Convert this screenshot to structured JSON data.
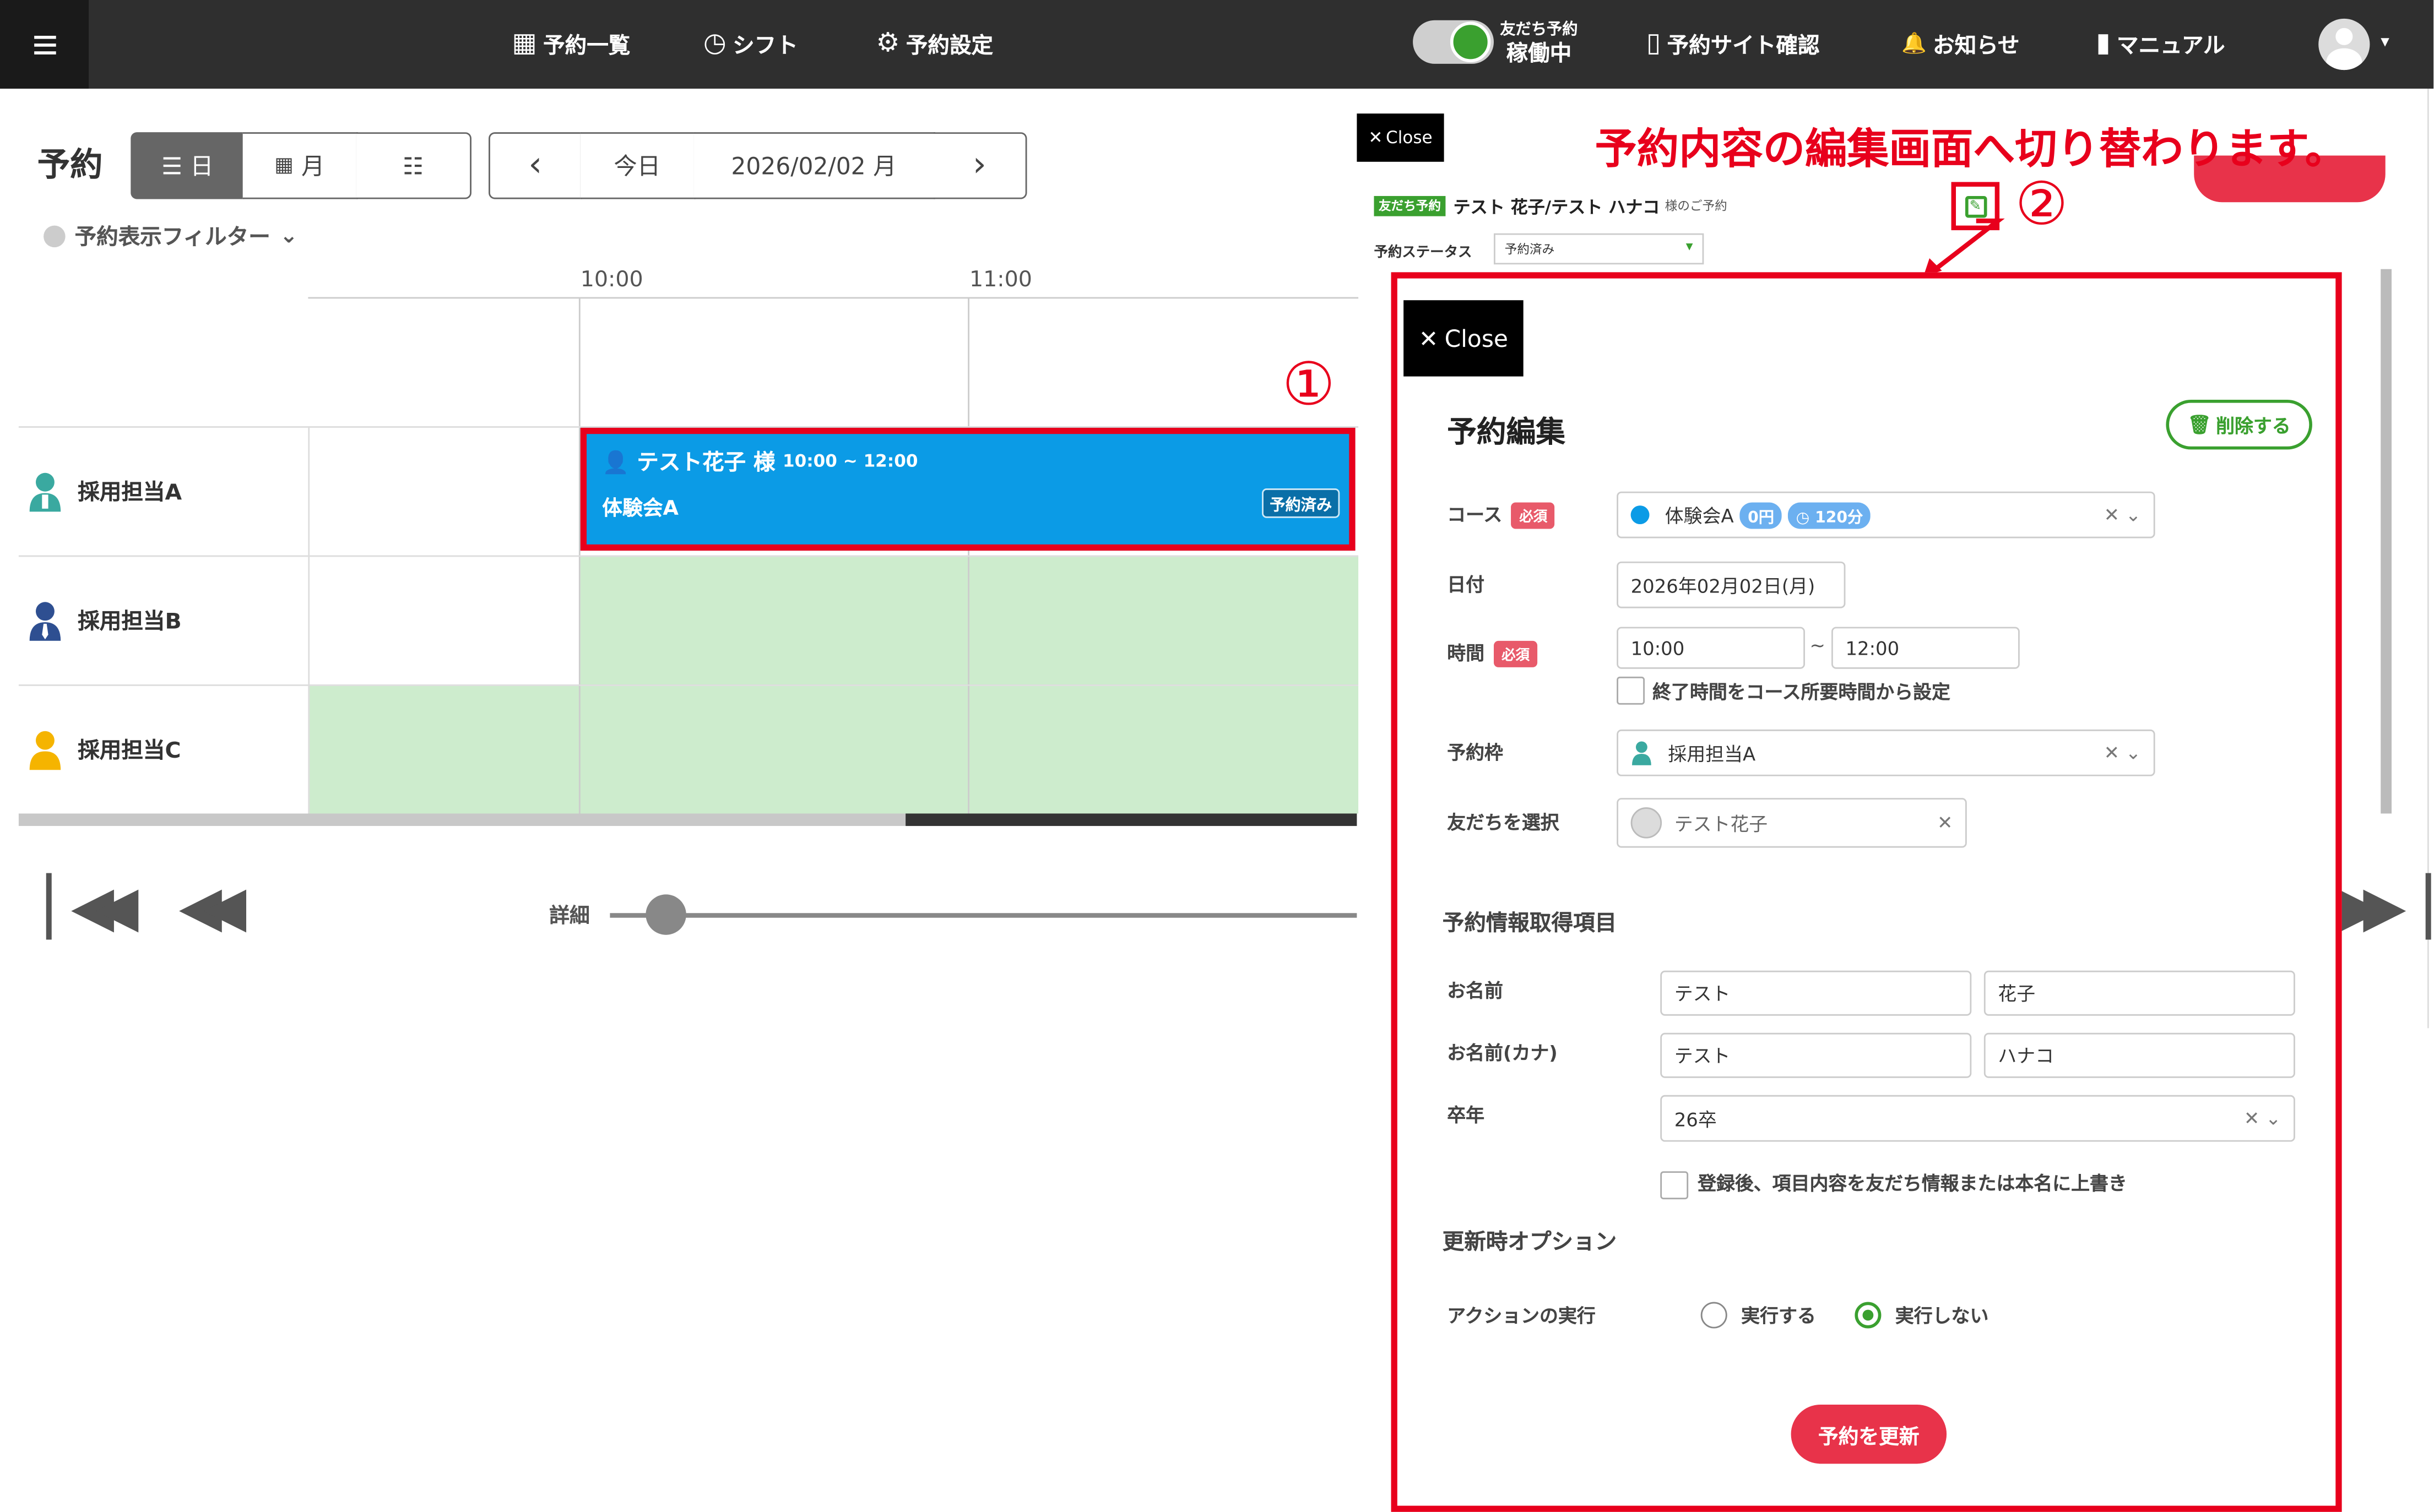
{
  "nav": {
    "items": [
      {
        "icon": "calendar-icon",
        "glyph": "▦",
        "label": "予約一覧"
      },
      {
        "icon": "clock-icon",
        "glyph": "◷",
        "label": "シフト"
      },
      {
        "icon": "gear-icon",
        "glyph": "⚙",
        "label": "予約設定"
      }
    ],
    "toggle_sub": "友だち予約",
    "toggle_main": "稼働中",
    "right_items": [
      {
        "icon": "phone-icon",
        "glyph": "▯",
        "label": "予約サイト確認"
      },
      {
        "icon": "bell-icon",
        "glyph": "🔔",
        "label": "お知らせ"
      },
      {
        "icon": "book-icon",
        "glyph": "▮",
        "label": "マニュアル"
      }
    ],
    "avatar_caret": "▾"
  },
  "toolbar": {
    "title": "予約",
    "view_day": "日",
    "view_month": "月",
    "view_list": "☷",
    "prev": "‹",
    "today": "今日",
    "date": "2026/02/02 月",
    "next": "›",
    "filter_label": "予約表示フィルター",
    "filter_caret": "⌄"
  },
  "calendar": {
    "times": [
      "10:00",
      "11:00"
    ],
    "staff": [
      {
        "name": "採用担当A",
        "icon_color": "#3aa9a0"
      },
      {
        "name": "採用担当B",
        "icon_color": "#2e4f91"
      },
      {
        "name": "採用担当C",
        "icon_color": "#f5b400"
      }
    ],
    "event": {
      "name": "テスト花子 様",
      "time": "10:00 ~ 12:00",
      "course": "体験会A",
      "status": "予約済み"
    },
    "detail_label": "詳細"
  },
  "annotations": {
    "step1": "①",
    "step2": "②",
    "message": "予約内容の編集画面へ切り替わります。"
  },
  "underlying": {
    "close": "Close",
    "tag": "友だち予約",
    "name": "テスト 花子/テスト ハナコ",
    "suffix": "様のご予約",
    "status_label": "予約ステータス",
    "status_value": "予約済み"
  },
  "modal": {
    "close": "Close",
    "title": "予約編集",
    "delete": "削除する",
    "required": "必須",
    "course": {
      "label": "コース",
      "value": "体験会A",
      "price": "0円",
      "duration": "120分",
      "color": "#0b9be6"
    },
    "date": {
      "label": "日付",
      "value": "2026年02月02日(月)"
    },
    "time": {
      "label": "時間",
      "start": "10:00",
      "sep": "~",
      "end": "12:00",
      "checkbox": "終了時間をコース所要時間から設定"
    },
    "slot": {
      "label": "予約枠",
      "value": "採用担当A"
    },
    "friend": {
      "label": "友だちを選択",
      "value": "テスト花子"
    },
    "section_info": "予約情報取得項目",
    "name": {
      "label": "お名前",
      "last": "テスト",
      "first": "花子"
    },
    "kana": {
      "label": "お名前(カナ)",
      "last": "テスト",
      "first": "ハナコ"
    },
    "grad": {
      "label": "卒年",
      "value": "26卒"
    },
    "overwrite": "登録後、項目内容を友だち情報または本名に上書き",
    "section_option": "更新時オプション",
    "action": {
      "label": "アクションの実行",
      "yes": "実行する",
      "no": "実行しない"
    },
    "update": "予約を更新"
  },
  "colors": {
    "accent_red": "#e8001c",
    "brand_green": "#3aa02f",
    "event_blue": "#0b9be6",
    "button_pink": "#e8334a"
  }
}
